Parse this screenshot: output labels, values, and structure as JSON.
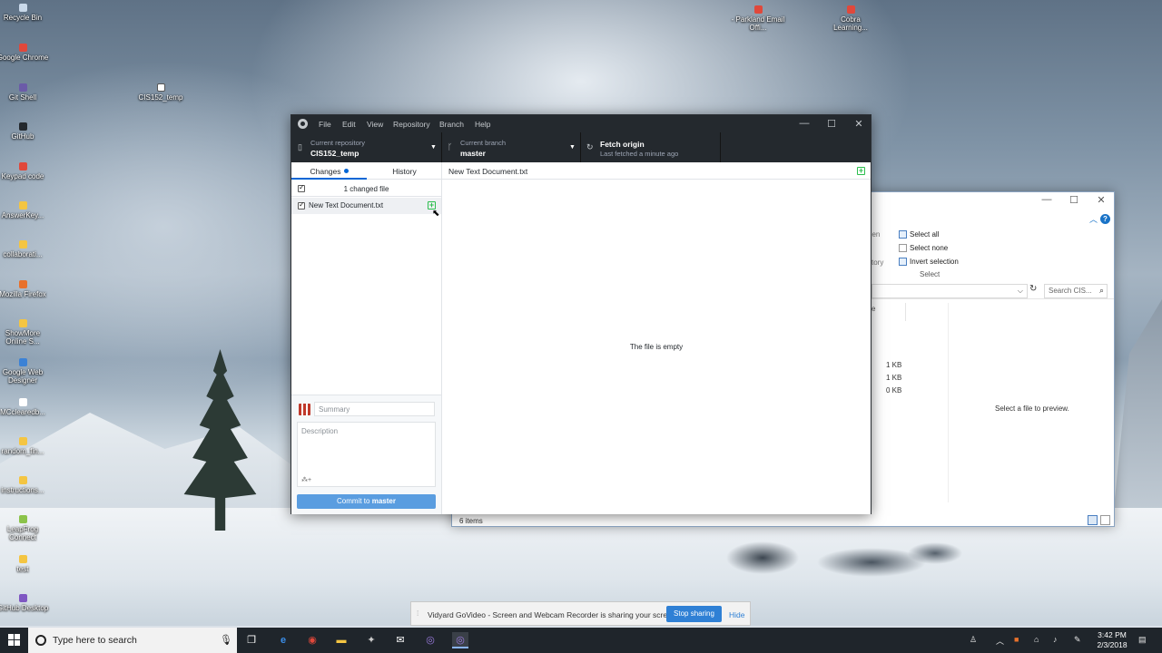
{
  "desktop": {
    "icons": [
      {
        "label": "Recycle Bin",
        "icon": "recycle-bin-icon",
        "color": "#c9d9ea"
      },
      {
        "label": "Google Chrome",
        "icon": "chrome-icon",
        "color": "#e0483b"
      },
      {
        "label": "Git Shell",
        "icon": "git-shell-icon",
        "color": "#6b5ba8"
      },
      {
        "label": "GitHub",
        "icon": "github-icon",
        "color": "#24292e"
      },
      {
        "label": "Keypad code",
        "icon": "shortcut-icon",
        "color": "#e0483b"
      },
      {
        "label": "AnswerKey...",
        "icon": "folder-icon",
        "color": "#f4c542"
      },
      {
        "label": "collaborati...",
        "icon": "folder-icon",
        "color": "#f4c542"
      },
      {
        "label": "Mozilla Firefox",
        "icon": "firefox-icon",
        "color": "#e8712c"
      },
      {
        "label": "ShowMore Online S...",
        "icon": "folder-icon",
        "color": "#f4c542"
      },
      {
        "label": "Google Web Designer",
        "icon": "web-designer-icon",
        "color": "#3b82d6"
      },
      {
        "label": "MCclearedb...",
        "icon": "document-icon",
        "color": "#ffffff"
      },
      {
        "label": "random_fin...",
        "icon": "folder-icon",
        "color": "#f4c542"
      },
      {
        "label": "instructions...",
        "icon": "folder-icon",
        "color": "#f4c542"
      },
      {
        "label": "LeapFrog Connect",
        "icon": "leapfrog-icon",
        "color": "#8bc34a"
      },
      {
        "label": "test",
        "icon": "folder-icon",
        "color": "#f4c542"
      },
      {
        "label": "GitHub Desktop",
        "icon": "github-desktop-icon",
        "color": "#7e57c2"
      }
    ],
    "middle_icon": {
      "label": "CIS152_temp",
      "icon": "checked-folder-icon"
    },
    "top_right_icons": [
      {
        "label": "- Parkland Email Offi...",
        "icon": "shortcut-icon",
        "color": "#e0483b"
      },
      {
        "label": "Cobra Learning...",
        "icon": "shortcut-icon",
        "color": "#e0483b"
      }
    ]
  },
  "explorer": {
    "ribbon": {
      "select_all": "Select all",
      "select_none": "Select none",
      "invert_selection": "Invert selection",
      "group_label": "Select",
      "fragment_open": "pen",
      "fragment_t": "t",
      "fragment_history": "story"
    },
    "search_placeholder": "Search CIS...",
    "column_fragment": "e",
    "sizes": [
      "1 KB",
      "1 KB",
      "0 KB"
    ],
    "preview_text": "Select a file to preview.",
    "status": "6 items"
  },
  "github_desktop": {
    "menu": [
      "File",
      "Edit",
      "View",
      "Repository",
      "Branch",
      "Help"
    ],
    "toolbar": {
      "repo_label": "Current repository",
      "repo_value": "CIS152_temp",
      "branch_label": "Current branch",
      "branch_value": "master",
      "fetch_title": "Fetch origin",
      "fetch_sub": "Last fetched a minute ago"
    },
    "tabs": {
      "changes": "Changes",
      "history": "History"
    },
    "changed_count": "1 changed file",
    "file_name": "New Text Document.txt",
    "diff_file": "New Text Document.txt",
    "empty_message": "The file is empty",
    "commit": {
      "summary_placeholder": "Summary",
      "description_placeholder": "Description",
      "button_prefix": "Commit to ",
      "button_branch": "master"
    },
    "accent": "#0366d6"
  },
  "share_bar": {
    "text": "Vidyard GoVideo - Screen and Webcam Recorder is sharing your screen.",
    "stop": "Stop sharing",
    "hide": "Hide"
  },
  "taskbar": {
    "search_placeholder": "Type here to search",
    "time": "3:42 PM",
    "date": "2/3/2018"
  }
}
